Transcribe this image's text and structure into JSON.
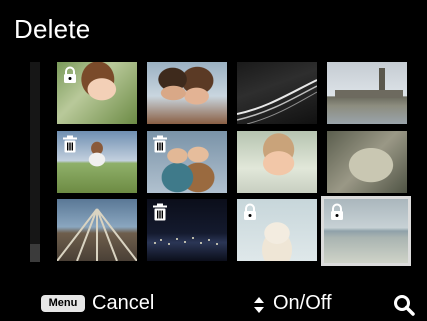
{
  "screen": {
    "title": "Delete"
  },
  "thumbnails": [
    {
      "name": "thumb-smiling-woman",
      "badge": "lock-icon",
      "selected": false
    },
    {
      "name": "thumb-couple-portrait",
      "badge": "",
      "selected": false
    },
    {
      "name": "thumb-night-road",
      "badge": "",
      "selected": false
    },
    {
      "name": "thumb-london-skyline",
      "badge": "",
      "selected": false
    },
    {
      "name": "thumb-jumping-girl",
      "badge": "trash-icon",
      "selected": false
    },
    {
      "name": "thumb-children-portrait",
      "badge": "trash-icon",
      "selected": false
    },
    {
      "name": "thumb-baby",
      "badge": "",
      "selected": false
    },
    {
      "name": "thumb-leaf-closeup",
      "badge": "",
      "selected": false
    },
    {
      "name": "thumb-amusement-ride",
      "badge": "",
      "selected": false
    },
    {
      "name": "thumb-city-night",
      "badge": "trash-icon",
      "selected": false
    },
    {
      "name": "thumb-teddy-bear",
      "badge": "lock-icon",
      "selected": false
    },
    {
      "name": "thumb-beach",
      "badge": "lock-icon",
      "selected": true
    }
  ],
  "footer": {
    "menu_key": "Menu",
    "cancel_label": "Cancel",
    "onoff_label": "On/Off",
    "search_icon": "search-icon",
    "updown_icon": "up-down-arrows-icon"
  }
}
